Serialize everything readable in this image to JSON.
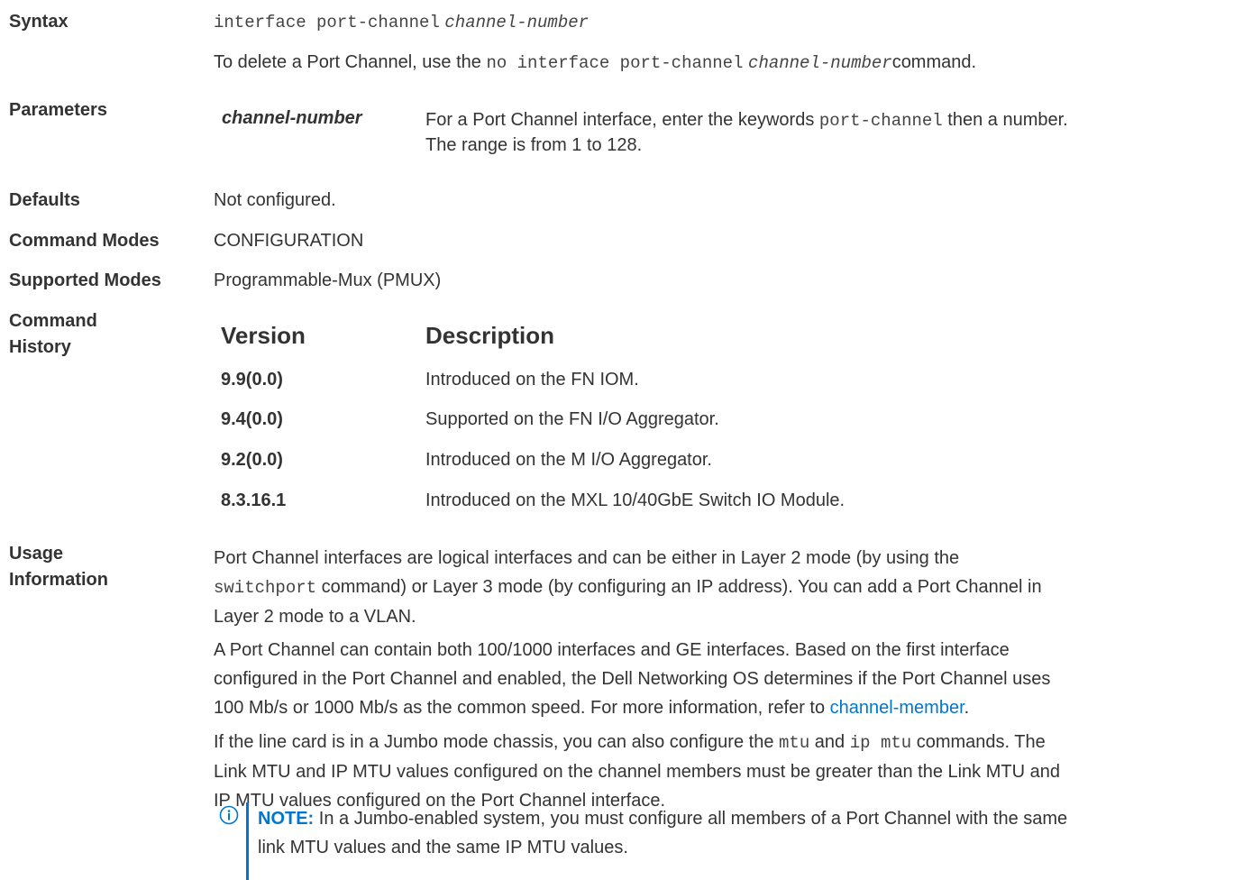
{
  "labels": {
    "syntax": "Syntax",
    "parameters": "Parameters",
    "defaults": "Defaults",
    "command_modes": "Command Modes",
    "supported_modes": "Supported Modes",
    "command_history_1": "Command",
    "command_history_2": "History",
    "usage_1": "Usage",
    "usage_2": "Information"
  },
  "syntax": {
    "command": "interface port-channel",
    "arg": "channel-number",
    "delete_pre": "To delete a Port Channel, use the",
    "delete_cmd": "no interface port-channel",
    "delete_arg": "channel-number",
    "delete_post": "command."
  },
  "parameters": {
    "name": "channel-number",
    "desc_pre": "For a Port Channel interface, enter the keywords",
    "desc_kw": "port-channel",
    "desc_post": "then a number.",
    "desc_line2": "The range is from 1 to 128."
  },
  "defaults": "Not configured.",
  "command_modes": "CONFIGURATION",
  "supported_modes": "Programmable-Mux (PMUX)",
  "history": {
    "col_version": "Version",
    "col_description": "Description",
    "rows": [
      {
        "version": "9.9(0.0)",
        "description": "Introduced on the FN IOM."
      },
      {
        "version": "9.4(0.0)",
        "description": "Supported on the FN I/O Aggregator."
      },
      {
        "version": "9.2(0.0)",
        "description": "Introduced on the M I/O Aggregator."
      },
      {
        "version": "8.3.16.1",
        "description": "Introduced on the MXL 10/40GbE Switch IO Module."
      }
    ]
  },
  "usage": {
    "p1_a": "Port Channel interfaces are logical interfaces and can be either in Layer 2 mode (by using the",
    "p1_code": "switchport",
    "p1_b": "command) or Layer 3 mode (by configuring an IP address). You can add a Port Channel in",
    "p1_c": "Layer 2 mode to a VLAN.",
    "p2_a": "A Port Channel can contain both 100/1000 interfaces and GE interfaces. Based on the first interface",
    "p2_b": "configured in the Port Channel and enabled, the Dell Networking OS determines if the Port Channel uses",
    "p2_c": "100 Mb/s or 1000 Mb/s as the common speed. For more information, refer to",
    "p2_link": "channel-member",
    "p2_end": ".",
    "p3_a": "If the line card is in a Jumbo mode chassis, you can also configure the",
    "p3_code1": "mtu",
    "p3_and": "and",
    "p3_code2": "ip mtu",
    "p3_b": "commands. The",
    "p3_c": "Link MTU and IP MTU values configured on the channel members must be greater than the Link MTU and",
    "p3_d": "IP MTU values configured on the Port Channel interface.",
    "note_label": "NOTE:",
    "note_a": "In a Jumbo-enabled system, you must configure all members of a Port Channel with the same",
    "note_b": "link MTU values and the same IP MTU values."
  },
  "colors": {
    "link": "#0076ce",
    "text": "#333333"
  },
  "icons": {
    "note": "info-circle-icon"
  }
}
